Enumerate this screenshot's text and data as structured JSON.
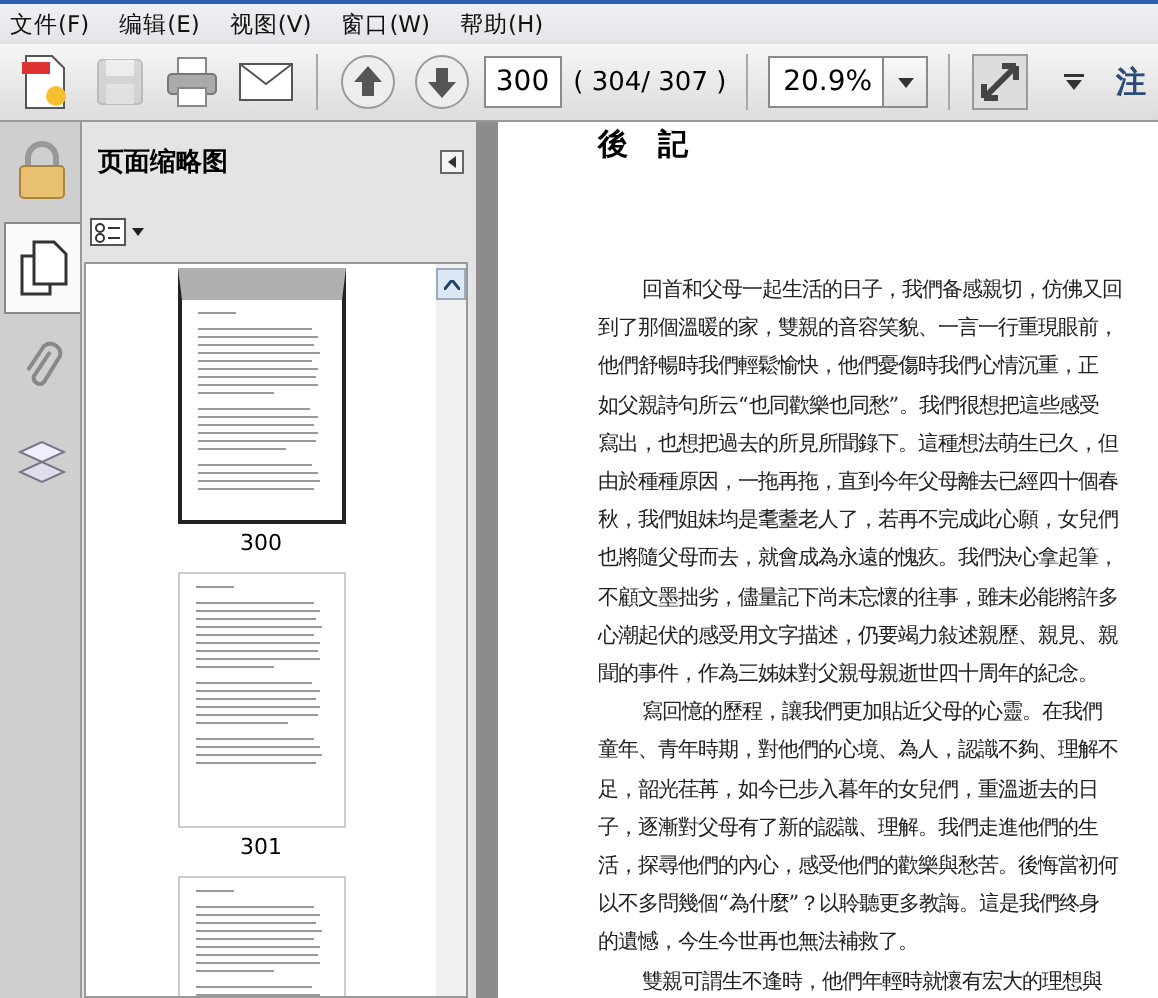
{
  "menu": [
    "文件(F)",
    "编辑(E)",
    "视图(V)",
    "窗口(W)",
    "帮助(H)"
  ],
  "toolbar": {
    "page_field": {
      "value": "300"
    },
    "page_count": "( 304/ 307 )",
    "zoom_field": {
      "value": "20.9%"
    },
    "comment_label": "注",
    "save_disabled": true
  },
  "sidebar": {
    "tabs": [
      {
        "kind": "lock",
        "selected": false
      },
      {
        "kind": "pages",
        "selected": true
      },
      {
        "kind": "attachments",
        "selected": false
      },
      {
        "kind": "layers",
        "selected": false
      }
    ],
    "title": "页面缩略图",
    "thumbnails": [
      {
        "label": "300",
        "selected": true
      },
      {
        "label": "301",
        "selected": false
      },
      {
        "selected": false
      }
    ]
  },
  "document": {
    "title": "後　記",
    "paragraphs": [
      [
        "回首和父母一起生活的日子，我們备感親切，仿佛又回",
        "到了那個溫暖的家，雙親的音容笑貌、一言一行重現眼前，",
        "他們舒暢時我們輕鬆愉快，他們憂傷時我們心情沉重，正",
        "如父親詩句所云“也同歡樂也同愁”。我們很想把這些感受",
        "寫出，也想把過去的所見所聞錄下。這種想法萌生已久，但",
        "由於種種原因，一拖再拖，直到今年父母離去已經四十個春",
        "秋，我們姐妹均是耄耋老人了，若再不完成此心願，女兒們",
        "也將隨父母而去，就會成為永遠的愧疚。我們決心拿起筆，",
        "不顧文墨拙劣，儘量記下尚未忘懷的往事，雖未必能將許多",
        "心潮起伏的感受用文字描述，仍要竭力敍述親歷、親見、親",
        "聞的事件，作為三姊妹對父親母親逝世四十周年的紀念。"
      ],
      [
        "寫回憶的歷程，讓我們更加貼近父母的心靈。在我們",
        "童年、青年時期，對他們的心境、為人，認識不夠、理解不",
        "足，韶光荏苒，如今已步入暮年的女兒們，重溫逝去的日",
        "子，逐漸對父母有了新的認識、理解。我們走進他們的生",
        "活，探尋他們的內心，感受他們的歡樂與愁苦。後悔當初何",
        "以不多問幾個“為什麼”？以聆聽更多教誨。這是我們终身",
        "的遺憾，今生今世再也無法補救了。"
      ],
      [
        "雙親可謂生不逢時，他們年輕時就懷有宏大的理想與"
      ]
    ]
  }
}
